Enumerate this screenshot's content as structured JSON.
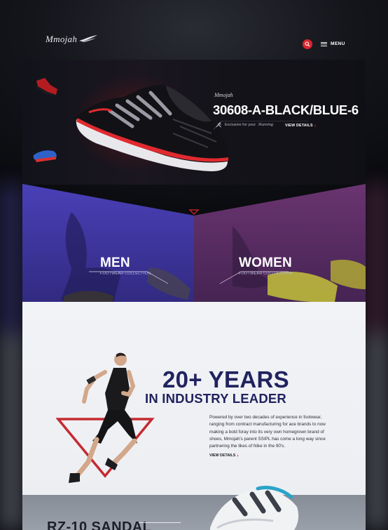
{
  "header": {
    "logo_text": "Mmojah",
    "menu_label": "MENU",
    "search_icon": "search-icon"
  },
  "hero": {
    "brand": "Mmojah",
    "product_title": "30608-A-BLACK/BLUE-6",
    "tagline_prefix": "Exclusive for your",
    "tagline_emphasis": "Running",
    "details_label": "VIEW DETAILS",
    "accent_color": "#d8262e"
  },
  "categories": [
    {
      "label": "MEN",
      "sub": "FOOTWEAR COLLECTION"
    },
    {
      "label": "WOMEN",
      "sub": "FOOTWEAR COLLOECTION"
    }
  ],
  "about": {
    "headline": "20+ YEARS",
    "subheadline": "IN INDUSTRY LEADER",
    "body": "Powered by over two decades of experience in footwear, ranging from contract manufacturing for ace brands to now making a bold foray into its very own homegrown brand of shoes, Mmojah's parent SSIPL has come a long way since partnering the likes of Nike in the 90's.",
    "details_label": "VIEW DETAILS",
    "headline_color": "#21235f"
  },
  "feature": {
    "title": "RZ-10 SANDAL"
  }
}
